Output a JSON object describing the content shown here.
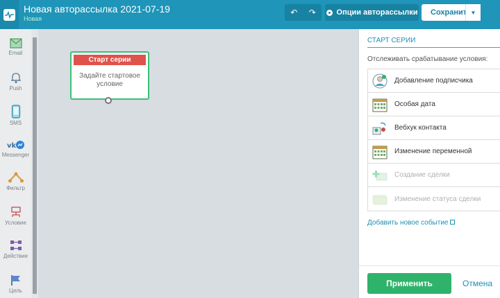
{
  "header": {
    "title": "Новая авторассылка 2021-07-19",
    "status": "Новая",
    "undo_icon": "↶",
    "redo_icon": "↷",
    "options_label": "Опции авторассылки",
    "save_label": "Сохранить",
    "save_dropdown_icon": "▼"
  },
  "toolbar": {
    "email": "Email",
    "push": "Push",
    "sms": "SMS",
    "messenger": "Messenger",
    "filter": "Фильтр",
    "condition": "Условие",
    "action": "Действие",
    "goal": "Цель"
  },
  "canvas": {
    "node_title": "Старт серии",
    "node_text": "Задайте стартовое условие"
  },
  "panel": {
    "title": "СТАРТ СЕРИИ",
    "subtitle": "Отслеживать срабатывание условия:",
    "items": [
      {
        "label": "Добавление подписчика",
        "icon": "subscriber-icon",
        "enabled": true
      },
      {
        "label": "Особая дата",
        "icon": "calendar-icon",
        "enabled": true
      },
      {
        "label": "Вебхук контакта",
        "icon": "webhook-icon",
        "enabled": true
      },
      {
        "label": "Изменение переменной",
        "icon": "calendar-grid-icon",
        "enabled": true
      },
      {
        "label": "Создание сделки",
        "icon": "deal-create-icon",
        "enabled": false
      },
      {
        "label": "Изменение статуса сделки",
        "icon": "deal-status-icon",
        "enabled": false
      }
    ],
    "add_event_label": "Добавить новое событие",
    "apply_label": "Применить",
    "cancel_label": "Отмена"
  },
  "colors": {
    "header": "#1e95b9",
    "accent": "#1e8fb2",
    "node_header": "#e0524c",
    "node_border": "#3bbf76",
    "apply": "#2fb36b"
  }
}
